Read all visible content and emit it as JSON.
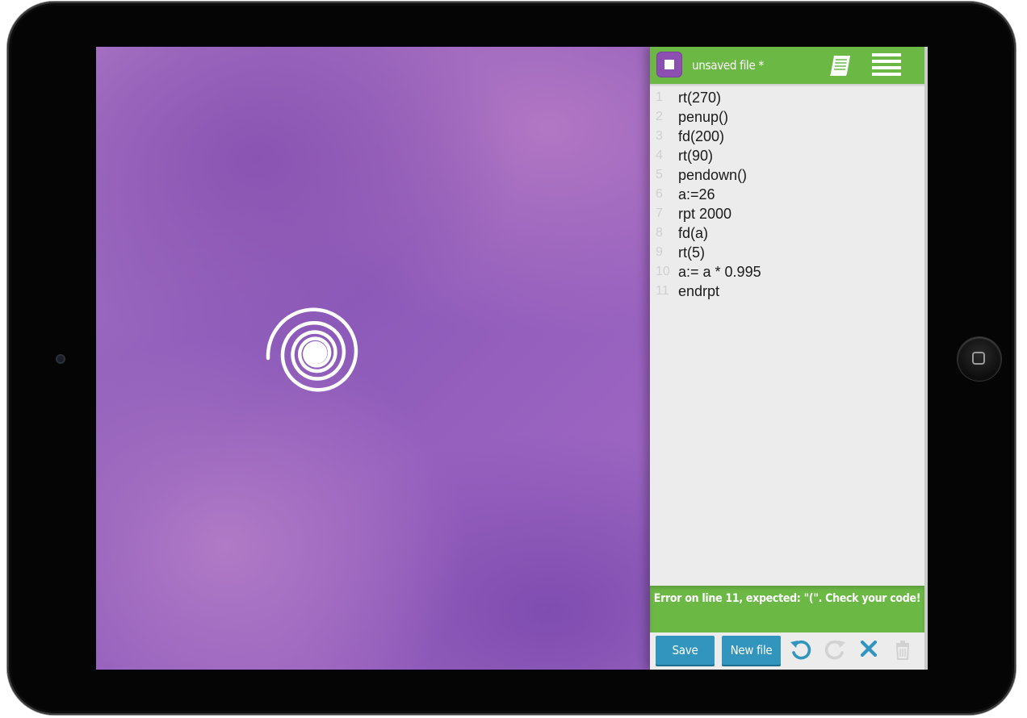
{
  "editor": {
    "file_title": "unsaved file *",
    "stop_icon": "stop-icon",
    "docs_icon": "book-icon",
    "menu_icon": "hamburger-menu-icon",
    "lines": [
      {
        "num": "1",
        "text": "rt(270)"
      },
      {
        "num": "2",
        "text": "penup()"
      },
      {
        "num": "3",
        "text": "fd(200)"
      },
      {
        "num": "4",
        "text": "rt(90)"
      },
      {
        "num": "5",
        "text": "pendown()"
      },
      {
        "num": "6",
        "text": "a:=26"
      },
      {
        "num": "7",
        "text": "rpt 2000"
      },
      {
        "num": "8",
        "text": "fd(a)"
      },
      {
        "num": "9",
        "text": "rt(5)"
      },
      {
        "num": "10",
        "text": "a:= a * 0.995"
      },
      {
        "num": "11",
        "text": "endrpt"
      }
    ],
    "error_message": "Error on line 11, expected: \"(\". Check your code!"
  },
  "footer": {
    "save_label": "Save",
    "new_file_label": "New file",
    "undo_icon": "undo-icon",
    "redo_icon": "redo-icon",
    "clear_icon": "close-icon",
    "delete_icon": "trash-icon"
  },
  "colors": {
    "accent_green": "#6cb845",
    "button_blue": "#3195be",
    "stop_purple": "#8e4fb3",
    "canvas_purple": "#9a63c0"
  }
}
